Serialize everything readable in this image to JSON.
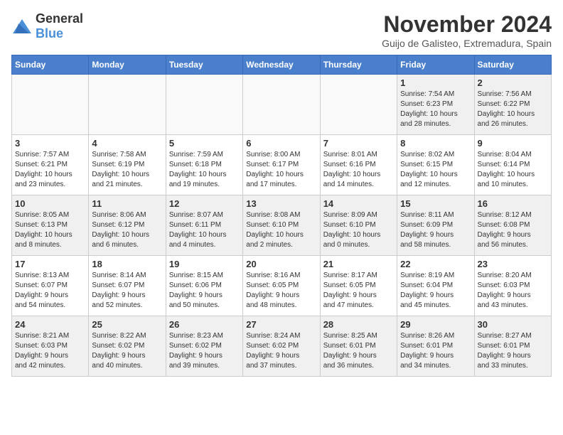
{
  "logo": {
    "general": "General",
    "blue": "Blue"
  },
  "title": "November 2024",
  "location": "Guijo de Galisteo, Extremadura, Spain",
  "weekdays": [
    "Sunday",
    "Monday",
    "Tuesday",
    "Wednesday",
    "Thursday",
    "Friday",
    "Saturday"
  ],
  "weeks": [
    [
      {
        "day": "",
        "info": ""
      },
      {
        "day": "",
        "info": ""
      },
      {
        "day": "",
        "info": ""
      },
      {
        "day": "",
        "info": ""
      },
      {
        "day": "",
        "info": ""
      },
      {
        "day": "1",
        "info": "Sunrise: 7:54 AM\nSunset: 6:23 PM\nDaylight: 10 hours\nand 28 minutes."
      },
      {
        "day": "2",
        "info": "Sunrise: 7:56 AM\nSunset: 6:22 PM\nDaylight: 10 hours\nand 26 minutes."
      }
    ],
    [
      {
        "day": "3",
        "info": "Sunrise: 7:57 AM\nSunset: 6:21 PM\nDaylight: 10 hours\nand 23 minutes."
      },
      {
        "day": "4",
        "info": "Sunrise: 7:58 AM\nSunset: 6:19 PM\nDaylight: 10 hours\nand 21 minutes."
      },
      {
        "day": "5",
        "info": "Sunrise: 7:59 AM\nSunset: 6:18 PM\nDaylight: 10 hours\nand 19 minutes."
      },
      {
        "day": "6",
        "info": "Sunrise: 8:00 AM\nSunset: 6:17 PM\nDaylight: 10 hours\nand 17 minutes."
      },
      {
        "day": "7",
        "info": "Sunrise: 8:01 AM\nSunset: 6:16 PM\nDaylight: 10 hours\nand 14 minutes."
      },
      {
        "day": "8",
        "info": "Sunrise: 8:02 AM\nSunset: 6:15 PM\nDaylight: 10 hours\nand 12 minutes."
      },
      {
        "day": "9",
        "info": "Sunrise: 8:04 AM\nSunset: 6:14 PM\nDaylight: 10 hours\nand 10 minutes."
      }
    ],
    [
      {
        "day": "10",
        "info": "Sunrise: 8:05 AM\nSunset: 6:13 PM\nDaylight: 10 hours\nand 8 minutes."
      },
      {
        "day": "11",
        "info": "Sunrise: 8:06 AM\nSunset: 6:12 PM\nDaylight: 10 hours\nand 6 minutes."
      },
      {
        "day": "12",
        "info": "Sunrise: 8:07 AM\nSunset: 6:11 PM\nDaylight: 10 hours\nand 4 minutes."
      },
      {
        "day": "13",
        "info": "Sunrise: 8:08 AM\nSunset: 6:10 PM\nDaylight: 10 hours\nand 2 minutes."
      },
      {
        "day": "14",
        "info": "Sunrise: 8:09 AM\nSunset: 6:10 PM\nDaylight: 10 hours\nand 0 minutes."
      },
      {
        "day": "15",
        "info": "Sunrise: 8:11 AM\nSunset: 6:09 PM\nDaylight: 9 hours\nand 58 minutes."
      },
      {
        "day": "16",
        "info": "Sunrise: 8:12 AM\nSunset: 6:08 PM\nDaylight: 9 hours\nand 56 minutes."
      }
    ],
    [
      {
        "day": "17",
        "info": "Sunrise: 8:13 AM\nSunset: 6:07 PM\nDaylight: 9 hours\nand 54 minutes."
      },
      {
        "day": "18",
        "info": "Sunrise: 8:14 AM\nSunset: 6:07 PM\nDaylight: 9 hours\nand 52 minutes."
      },
      {
        "day": "19",
        "info": "Sunrise: 8:15 AM\nSunset: 6:06 PM\nDaylight: 9 hours\nand 50 minutes."
      },
      {
        "day": "20",
        "info": "Sunrise: 8:16 AM\nSunset: 6:05 PM\nDaylight: 9 hours\nand 48 minutes."
      },
      {
        "day": "21",
        "info": "Sunrise: 8:17 AM\nSunset: 6:05 PM\nDaylight: 9 hours\nand 47 minutes."
      },
      {
        "day": "22",
        "info": "Sunrise: 8:19 AM\nSunset: 6:04 PM\nDaylight: 9 hours\nand 45 minutes."
      },
      {
        "day": "23",
        "info": "Sunrise: 8:20 AM\nSunset: 6:03 PM\nDaylight: 9 hours\nand 43 minutes."
      }
    ],
    [
      {
        "day": "24",
        "info": "Sunrise: 8:21 AM\nSunset: 6:03 PM\nDaylight: 9 hours\nand 42 minutes."
      },
      {
        "day": "25",
        "info": "Sunrise: 8:22 AM\nSunset: 6:02 PM\nDaylight: 9 hours\nand 40 minutes."
      },
      {
        "day": "26",
        "info": "Sunrise: 8:23 AM\nSunset: 6:02 PM\nDaylight: 9 hours\nand 39 minutes."
      },
      {
        "day": "27",
        "info": "Sunrise: 8:24 AM\nSunset: 6:02 PM\nDaylight: 9 hours\nand 37 minutes."
      },
      {
        "day": "28",
        "info": "Sunrise: 8:25 AM\nSunset: 6:01 PM\nDaylight: 9 hours\nand 36 minutes."
      },
      {
        "day": "29",
        "info": "Sunrise: 8:26 AM\nSunset: 6:01 PM\nDaylight: 9 hours\nand 34 minutes."
      },
      {
        "day": "30",
        "info": "Sunrise: 8:27 AM\nSunset: 6:01 PM\nDaylight: 9 hours\nand 33 minutes."
      }
    ]
  ]
}
